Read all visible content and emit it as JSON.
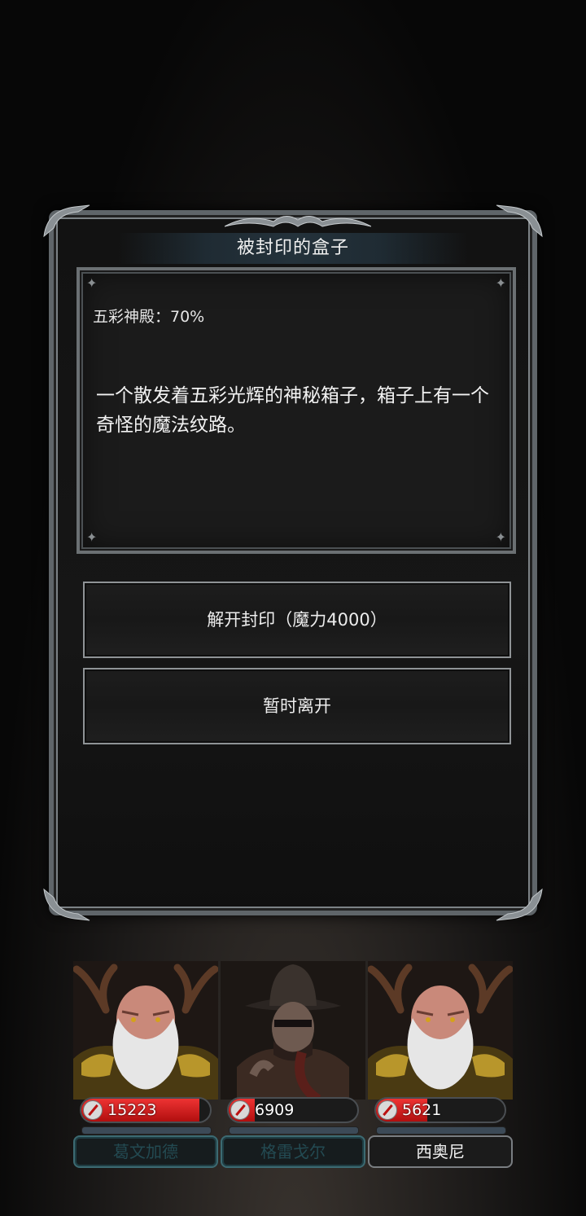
{
  "dialog": {
    "title": "被封印的盒子",
    "subtitle": "五彩神殿：70%",
    "description": "一个散发着五彩光辉的神秘箱子，箱子上有一个奇怪的魔法纹路。",
    "options": [
      {
        "label": "解开封印（魔力4000）"
      },
      {
        "label": "暂时离开"
      }
    ]
  },
  "party": [
    {
      "name": "葛文加德",
      "hp": "15223",
      "hp_fill": 0.92,
      "portrait": "antlered-elder-portrait",
      "selected": true
    },
    {
      "name": "格雷戈尔",
      "hp": "6909",
      "hp_fill": 0.2,
      "portrait": "hunter-hat-portrait",
      "selected": true
    },
    {
      "name": "西奥尼",
      "hp": "5621",
      "hp_fill": 0.4,
      "portrait": "antlered-elder-portrait",
      "selected": false
    }
  ],
  "colors": {
    "hp_red": "#cc1a1a",
    "frame_silver": "#7c8286",
    "name_teal": "#3c6a72"
  },
  "icons": {
    "hp": "sword-icon",
    "sparkle": "sparkle-icon"
  }
}
